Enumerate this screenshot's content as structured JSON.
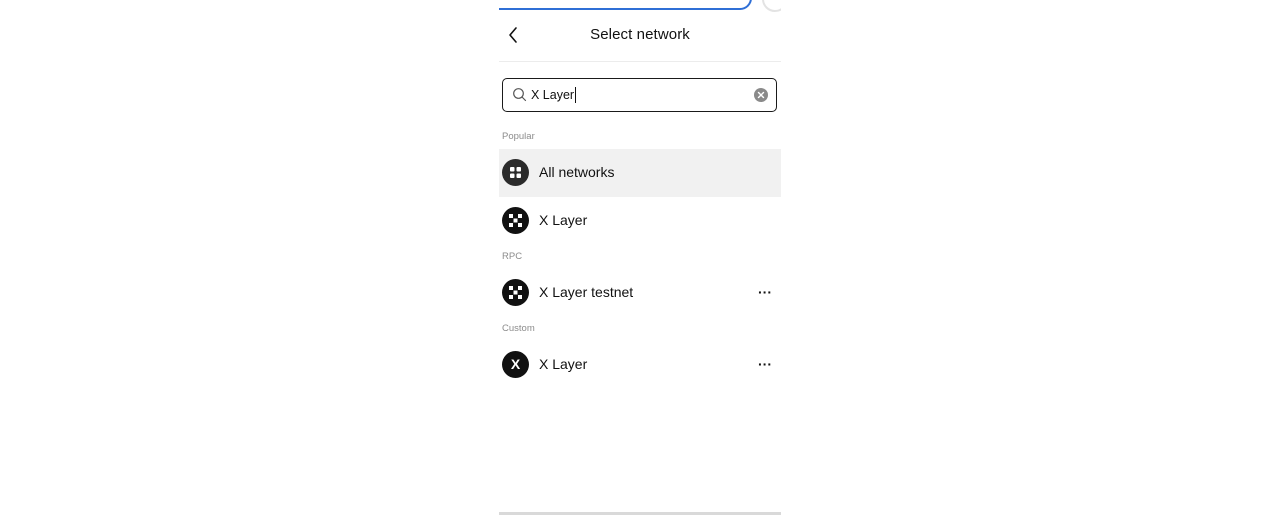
{
  "header": {
    "title": "Select network",
    "back_icon": "chevron-left-icon"
  },
  "search": {
    "value": "X Layer",
    "search_icon": "search-icon",
    "clear_icon": "clear-circle-icon"
  },
  "sections": {
    "popular": {
      "label": "Popular",
      "items": [
        {
          "label": "All networks",
          "icon": "grid-icon",
          "selected": true
        },
        {
          "label": "X Layer",
          "icon": "xlayer-logo-icon"
        }
      ]
    },
    "rpc": {
      "label": "RPC",
      "items": [
        {
          "label": "X Layer testnet",
          "icon": "xlayer-logo-icon",
          "more": "···"
        }
      ]
    },
    "custom": {
      "label": "Custom",
      "items": [
        {
          "label": "X Layer",
          "icon": "x-letter-icon",
          "letter": "X",
          "more": "···"
        }
      ]
    }
  },
  "colors": {
    "accent": "#2f6fd6",
    "selected_row_bg": "#f1f1f1",
    "icon_bg": "#111111"
  }
}
